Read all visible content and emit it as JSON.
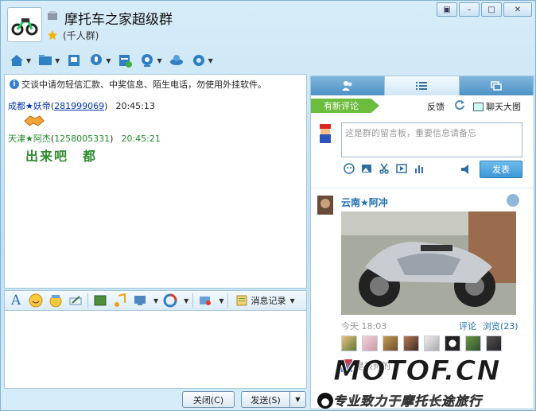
{
  "window": {
    "title": "摩托车之家超级群",
    "subtitle": "(千人群)"
  },
  "window_buttons": [
    "▣",
    "–",
    "□",
    "✕"
  ],
  "chat": {
    "notice": "交谈中请勿轻信汇款、中奖信息、陌生电话，勿使用外挂软件。",
    "messages": [
      {
        "nick": "成都★妖帝",
        "qq": "281999069",
        "time": "20:45:13"
      },
      {
        "nick": "天津★阿杰",
        "qq": "1258005331",
        "time": "20:45:21",
        "text": "出来吧　都"
      }
    ]
  },
  "format_bar": {
    "history_label": "消息记录"
  },
  "buttons": {
    "close": "关闭(C)",
    "send": "发送(S)"
  },
  "side": {
    "new_comment": "有新评论",
    "feedback": "反馈",
    "big_pic": "聊天大图",
    "placeholder": "这是群的留言板，重要信息请备忘",
    "publish": "发表",
    "post": {
      "name": "云南★阿冲",
      "date": "今天 18:03",
      "comment": "评论",
      "views": "浏览(23)"
    },
    "comment_preview": "是很帅的"
  },
  "watermark": {
    "big": "MOTOF.CN",
    "small": "专业致力于摩托长途旅行"
  },
  "colors": {
    "accent": "#3e97d6",
    "green_badge": "#6cbc3e",
    "nick_green": "#1f8a2b",
    "nick_blue": "#0033aa"
  }
}
